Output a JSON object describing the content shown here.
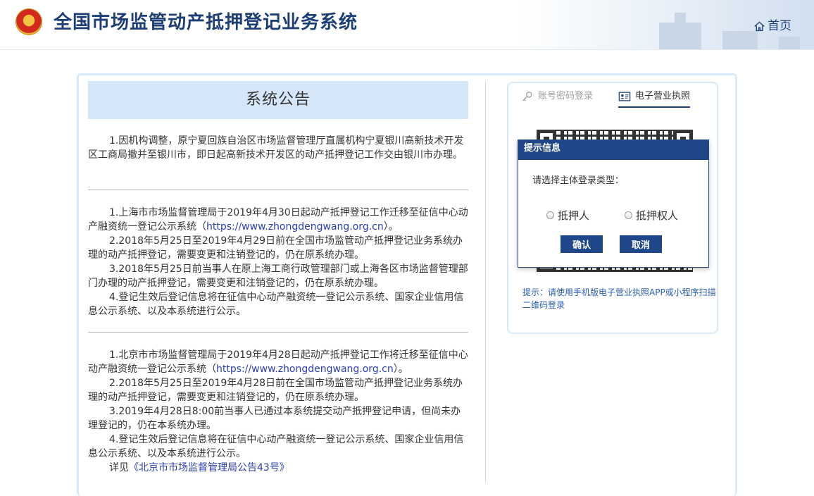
{
  "header": {
    "title": "全国市场监管动产抵押登记业务系统",
    "home_label": "首页"
  },
  "notice": {
    "title": "系统公告",
    "blocks": [
      {
        "paragraphs": [
          "1.因机构调整，原宁夏回族自治区市场监督管理厅直属机构宁夏银川高新技术开发区工商局撤并至银川市，即日起高新技术开发区的动产抵押登记工作交由银川市办理。"
        ]
      },
      {
        "p1_before": "1.上海市市场监督管理局于2019年4月30日起动产抵押登记工作迁移至征信中心动产融资统一登记公示系统（",
        "p1_link": "https://www.zhongdengwang.org.cn",
        "p1_after": "）。",
        "p2": "2.2018年5月25日至2019年4月29日前在全国市场监管动产抵押登记业务系统办理的动产抵押登记，需要变更和注销登记的，仍在原系统办理。",
        "p3": "3.2018年5月25日前当事人在原上海工商行政管理部门或上海各区市场监督管理部门办理的动产抵押登记，需要变更和注销登记的，仍在原系统办理。",
        "p4": "4.登记生效后登记信息将在征信中心动产融资统一登记公示系统、国家企业信用信息公示系统、以及本系统进行公示。"
      },
      {
        "p1_before": "1.北京市市场监督管理局于2019年4月28日起动产抵押登记工作将迁移至征信中心动产融资统一登记公示系统（",
        "p1_link": "https://www.zhongdengwang.org.cn",
        "p1_after": "）。",
        "p2": "2.2018年5月25日至2019年4月28日前在全国市场监管动产抵押登记业务系统办理的动产抵押登记，需要变更和注销登记的，仍在原系统办理。",
        "p3": "3.2019年4月28日8:00前当事人已通过本系统提交动产抵押登记申请，但尚未办理登记的，仍在本系统办理。",
        "p4": "4.登记生效后登记信息将在征信中心动产融资统一登记公示系统、国家企业信用信息公示系统、以及本系统进行公示。",
        "detail_prefix": "详见",
        "detail_link": "《北京市市场监督管理局公告43号》"
      }
    ]
  },
  "login": {
    "tab_password": "账号密码登录",
    "tab_license": "电子营业执照",
    "hint": "提示：请使用手机版电子营业执照APP或小程序扫描二维码登录"
  },
  "dialog": {
    "title": "提示信息",
    "prompt": "请选择主体登录类型：",
    "option_1": "抵押人",
    "option_2": "抵押权人",
    "confirm": "确认",
    "cancel": "取消"
  },
  "colors": {
    "brand_blue": "#1f4688",
    "notice_header_bg": "#d5e6f8",
    "link": "#2a3fb3",
    "hint_text": "#2a5fb0"
  }
}
